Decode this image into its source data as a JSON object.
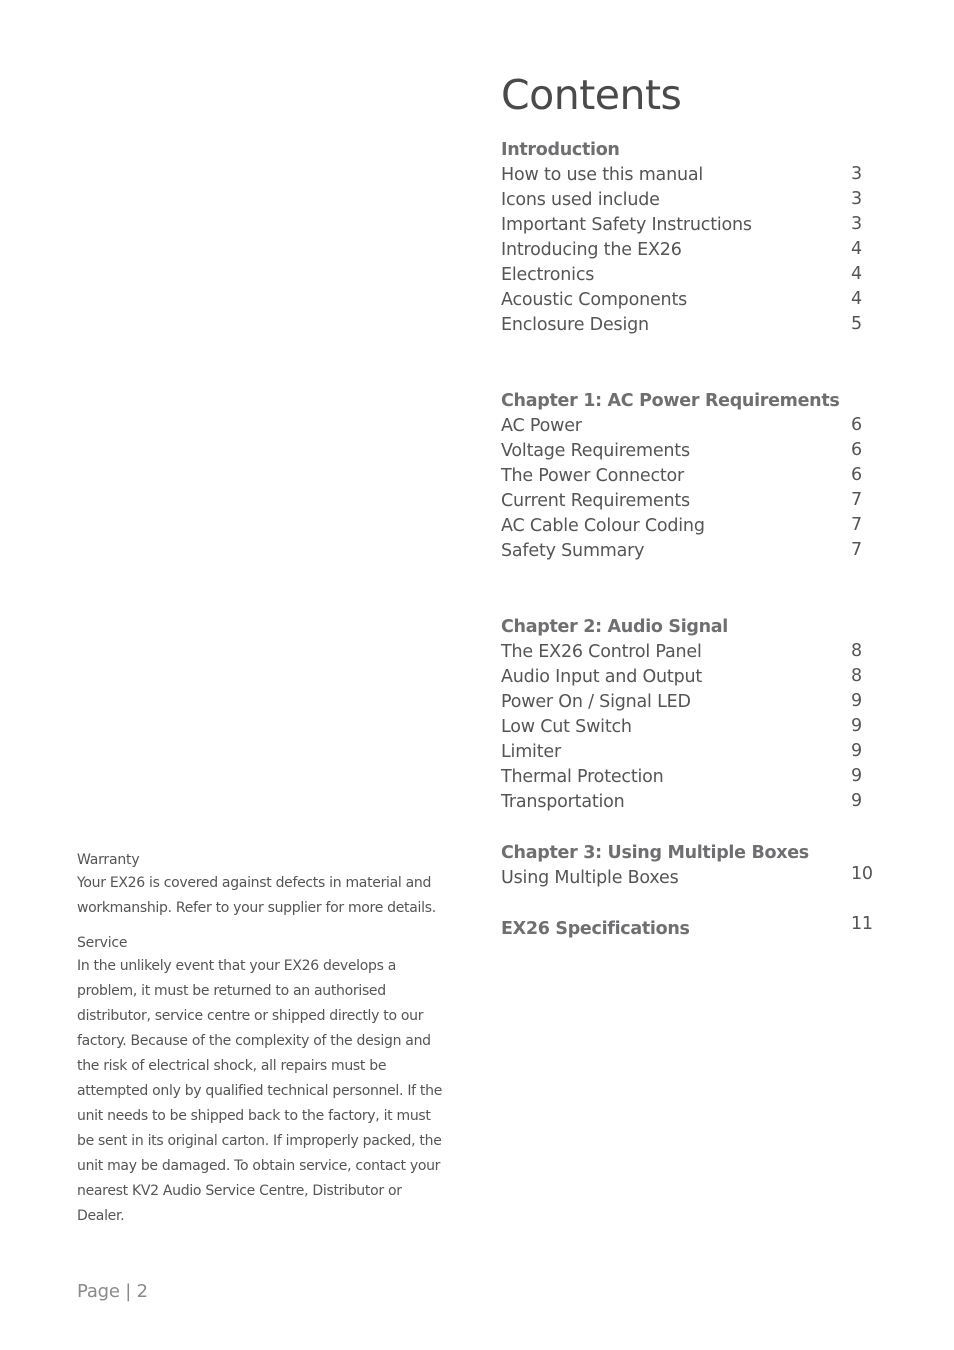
{
  "contents": {
    "title": "Contents",
    "sections": [
      {
        "heading": "Introduction",
        "page": null,
        "entries": [
          {
            "label": "How to use this manual",
            "page": "3"
          },
          {
            "label": "Icons used include",
            "page": "3"
          },
          {
            "label": "Important Safety Instructions",
            "page": "3"
          },
          {
            "label": "Introducing the EX26",
            "page": "4"
          },
          {
            "label": "Electronics",
            "page": "4"
          },
          {
            "label": "Acoustic Components",
            "page": "4"
          },
          {
            "label": "Enclosure Design",
            "page": "5"
          }
        ]
      },
      {
        "heading": "Chapter 1: AC Power Requirements",
        "page": null,
        "entries": [
          {
            "label": "AC Power",
            "page": "6"
          },
          {
            "label": "Voltage Requirements",
            "page": "6"
          },
          {
            "label": "The Power Connector",
            "page": "6"
          },
          {
            "label": "Current Requirements",
            "page": "7"
          },
          {
            "label": "AC Cable Colour Coding",
            "page": "7"
          },
          {
            "label": "Safety Summary",
            "page": "7"
          }
        ]
      },
      {
        "heading": "Chapter 2: Audio Signal",
        "page": null,
        "entries": [
          {
            "label": "The EX26 Control Panel",
            "page": "8"
          },
          {
            "label": "Audio Input and Output",
            "page": "8"
          },
          {
            "label": "Power On / Signal LED",
            "page": "9"
          },
          {
            "label": "Low Cut Switch",
            "page": "9"
          },
          {
            "label": "Limiter",
            "page": "9"
          },
          {
            "label": "Thermal Protection",
            "page": "9"
          },
          {
            "label": "Transportation",
            "page": "9"
          }
        ]
      },
      {
        "heading": "Chapter 3: Using Multiple Boxes",
        "page": null,
        "entries": [
          {
            "label": "Using Multiple Boxes",
            "page": "10"
          }
        ]
      },
      {
        "heading": "EX26 Specifications",
        "page": "11",
        "entries": []
      }
    ]
  },
  "sidebar": {
    "warranty": {
      "heading": "Warranty",
      "body": "Your EX26 is covered against defects in material and workmanship. Refer to your supplier for more details."
    },
    "service": {
      "heading": "Service",
      "body": "In the unlikely event that your EX26 develops a problem, it must be returned to an authorised distributor, service centre or shipped directly to our factory. Because of the complexity of the design and the risk of electrical shock, all repairs must be attempted only by qualified technical personnel. If the unit needs to be shipped back to the factory, it must be sent in its original carton. If improperly packed, the unit may be damaged. To obtain service, contact your nearest KV2 Audio Service Centre, Distributor or Dealer."
    }
  },
  "footer": {
    "page_label": "Page | 2"
  }
}
